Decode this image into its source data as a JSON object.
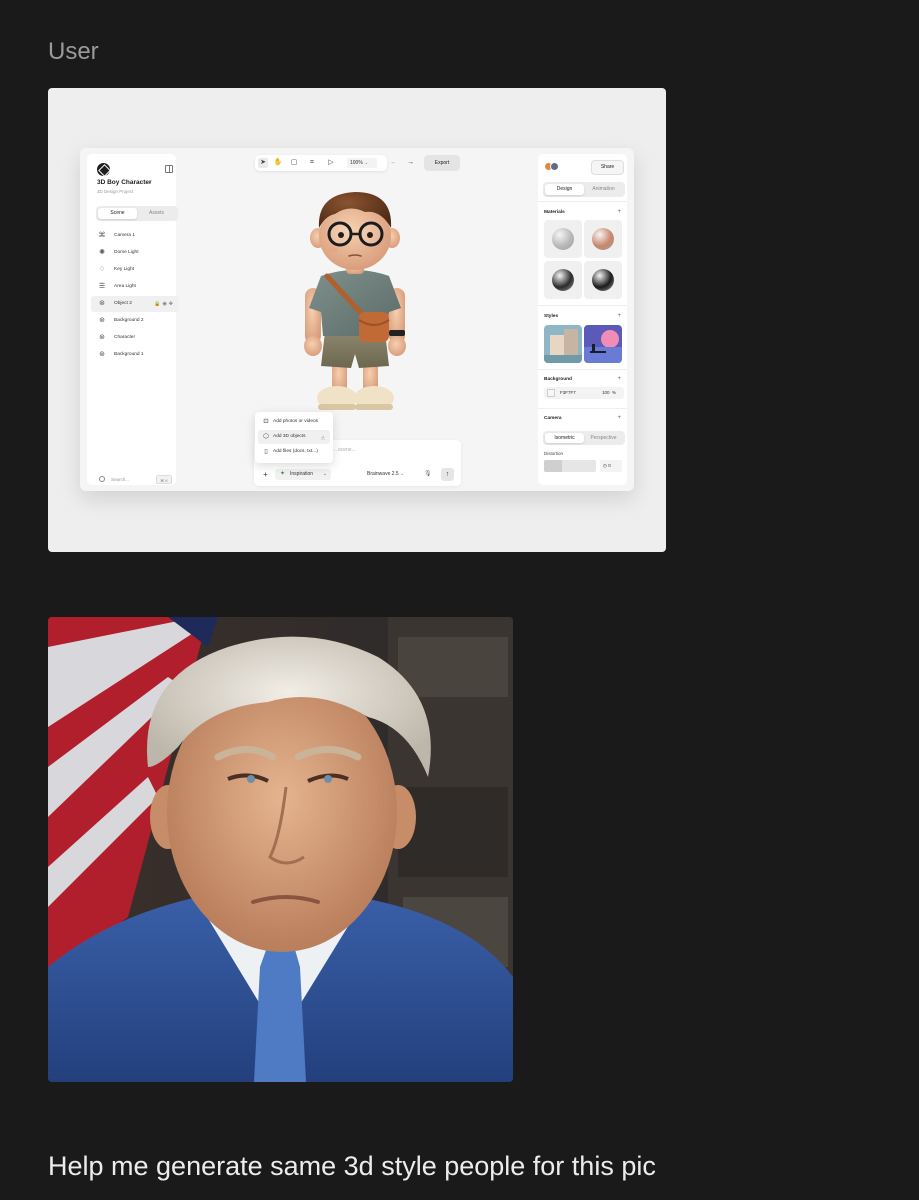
{
  "conversation": {
    "role_label": "User",
    "message": "Help me generate same 3d style people for this pic"
  },
  "design_app": {
    "project": {
      "title": "3D Boy Character",
      "subtitle": "3D Design Project"
    },
    "left_tabs": [
      {
        "label": "Scene",
        "active": true
      },
      {
        "label": "Assets",
        "active": false
      }
    ],
    "scene_items": [
      {
        "label": "Camera 1",
        "icon": "camera-icon",
        "selected": false
      },
      {
        "label": "Dome Light",
        "icon": "dome-light-icon",
        "selected": false
      },
      {
        "label": "Key Light",
        "icon": "key-light-icon",
        "selected": false
      },
      {
        "label": "Area Light",
        "icon": "area-light-icon",
        "selected": false
      },
      {
        "label": "Object 2",
        "icon": "object-icon",
        "selected": true
      },
      {
        "label": "Background 2",
        "icon": "object-icon",
        "selected": false
      },
      {
        "label": "Character",
        "icon": "object-icon",
        "selected": false
      },
      {
        "label": "Background 1",
        "icon": "object-icon",
        "selected": false
      }
    ],
    "search": {
      "placeholder": "Search...",
      "shortcut": "⌘ K"
    },
    "toolbar": {
      "tools": [
        "select-tool-icon",
        "hand-tool-icon",
        "comment-tool-icon",
        "crop-tool-icon",
        "play-icon"
      ],
      "zoom": "100%",
      "export_label": "Export"
    },
    "add_menu": {
      "items": [
        {
          "label": "Add photos or videos",
          "icon": "image-icon",
          "highlighted": false
        },
        {
          "label": "Add 3D objects",
          "icon": "cube-icon",
          "highlighted": true
        },
        {
          "label": "Add files (docs, txt...)",
          "icon": "file-icon",
          "highlighted": false
        }
      ]
    },
    "prompt": {
      "placeholder": "...scene...",
      "inspiration_label": "Inspiration",
      "model_label": "Brainwave 2.5"
    },
    "right_panel": {
      "share_label": "Share",
      "tabs": [
        {
          "label": "Design",
          "active": true
        },
        {
          "label": "Animation",
          "active": false
        }
      ],
      "materials_heading": "Materials",
      "material_colors": [
        "#b8b8b8",
        "#c9866c",
        "#2a2a2a",
        "#1a1a1a"
      ],
      "styles_heading": "Styles",
      "background_heading": "Background",
      "background_hex": "F3F7F7",
      "background_opacity": "100",
      "background_opacity_unit": "%",
      "camera_heading": "Camera",
      "camera_tabs": [
        {
          "label": "Isometric",
          "active": true
        },
        {
          "label": "Perspective",
          "active": false
        }
      ],
      "distortion_label": "Distortion",
      "distortion_value": "0",
      "distortion_level": 0.35
    }
  },
  "colors": {
    "page_background": "#1a1a1a",
    "text": "#ececec",
    "muted_text": "#9a9a9a"
  }
}
